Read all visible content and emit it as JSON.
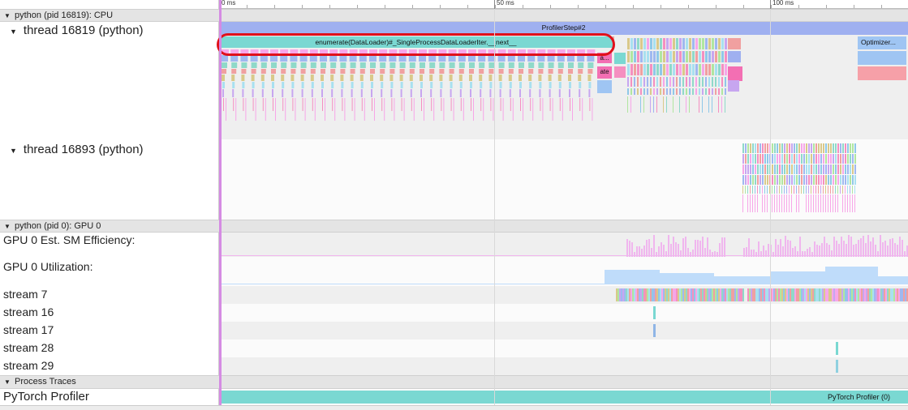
{
  "ruler": {
    "ticks": [
      {
        "label": "0 ms",
        "pos": 0
      },
      {
        "label": "50 ms",
        "pos": 0.4
      },
      {
        "label": "100 ms",
        "pos": 0.8
      }
    ]
  },
  "cpu_process": {
    "header": "python (pid 16819): CPU",
    "thread1": {
      "label": "thread 16819 (python)",
      "profiler_step": "ProfilerStep#2",
      "dataloader_slice": "enumerate(DataLoader)#_SingleProcessDataLoaderIter.__next__",
      "small_a": "a...",
      "small_ate": "ate",
      "optimizer": "Optimizer..."
    },
    "thread2": {
      "label": "thread 16893 (python)"
    }
  },
  "gpu_process": {
    "header": "python (pid 0): GPU 0",
    "sm_efficiency": "GPU 0 Est. SM Efficiency:",
    "utilization": "GPU 0 Utilization:",
    "streams": [
      "stream 7",
      "stream 16",
      "stream 17",
      "stream 28",
      "stream 29"
    ]
  },
  "process_traces": {
    "header": "Process Traces",
    "pytorch_profiler": "PyTorch Profiler",
    "pytorch_profiler_slice": "PyTorch Profiler (0)"
  },
  "colors": {
    "cursor": "#d58be3",
    "highlight": "#e0101a",
    "teal": "#7ad8d2",
    "profiler_step": "#9fb0f0",
    "utilization": "#bfdcfa",
    "sm": "#f0b6ee"
  }
}
